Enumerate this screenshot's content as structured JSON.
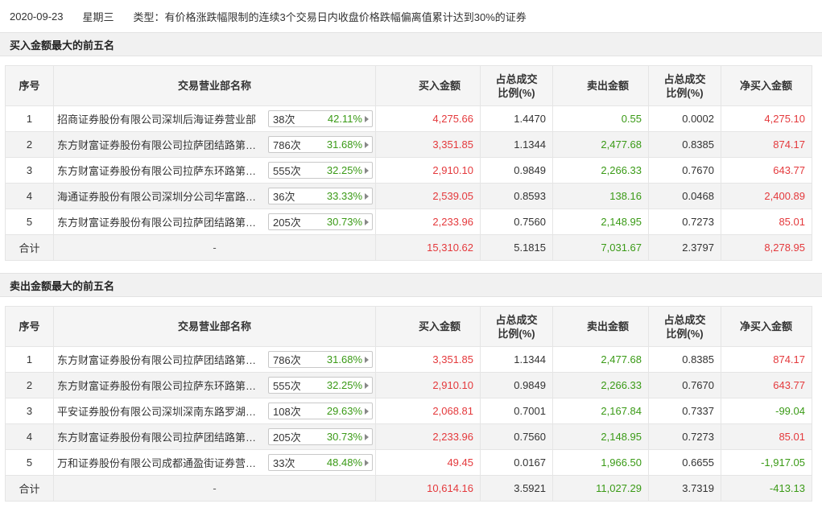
{
  "header": {
    "date": "2020-09-23",
    "weekday": "星期三",
    "type_text": "类型：有价格涨跌幅限制的连续3个交易日内收盘价格跌幅偏离值累计达到30%的证券"
  },
  "columns": {
    "seq": "序号",
    "dept": "交易营业部名称",
    "buy_amount": "买入金额",
    "buy_ratio_l1": "占总成交",
    "buy_ratio_l2": "比例(%)",
    "sell_amount": "卖出金额",
    "sell_ratio_l1": "占总成交",
    "sell_ratio_l2": "比例(%)",
    "net_buy": "净买入金额"
  },
  "colors": {
    "up": "#e4393c",
    "down": "#3a9a16"
  },
  "buy_top5": {
    "title": "买入金额最大的前五名",
    "rows": [
      {
        "seq": "1",
        "name": "招商证券股份有限公司深圳后海证券营业部",
        "times": "38次",
        "pct": "42.11%",
        "buy": "4,275.66",
        "buy_ratio": "1.4470",
        "sell": "0.55",
        "sell_ratio": "0.0002",
        "net": "4,275.10",
        "net_sign": "up"
      },
      {
        "seq": "2",
        "name": "东方财富证券股份有限公司拉萨团结路第二证券营业部",
        "times": "786次",
        "pct": "31.68%",
        "buy": "3,351.85",
        "buy_ratio": "1.1344",
        "sell": "2,477.68",
        "sell_ratio": "0.8385",
        "net": "874.17",
        "net_sign": "up"
      },
      {
        "seq": "3",
        "name": "东方财富证券股份有限公司拉萨东环路第二证券营业部",
        "times": "555次",
        "pct": "32.25%",
        "buy": "2,910.10",
        "buy_ratio": "0.9849",
        "sell": "2,266.33",
        "sell_ratio": "0.7670",
        "net": "643.77",
        "net_sign": "up"
      },
      {
        "seq": "4",
        "name": "海通证券股份有限公司深圳分公司华富路证券营业部",
        "times": "36次",
        "pct": "33.33%",
        "buy": "2,539.05",
        "buy_ratio": "0.8593",
        "sell": "138.16",
        "sell_ratio": "0.0468",
        "net": "2,400.89",
        "net_sign": "up"
      },
      {
        "seq": "5",
        "name": "东方财富证券股份有限公司拉萨团结路第一证券营业部",
        "times": "205次",
        "pct": "30.73%",
        "buy": "2,233.96",
        "buy_ratio": "0.7560",
        "sell": "2,148.95",
        "sell_ratio": "0.7273",
        "net": "85.01",
        "net_sign": "up"
      }
    ],
    "total": {
      "label": "合计",
      "name": "-",
      "buy": "15,310.62",
      "buy_ratio": "5.1815",
      "sell": "7,031.67",
      "sell_ratio": "2.3797",
      "net": "8,278.95",
      "net_sign": "up"
    }
  },
  "sell_top5": {
    "title": "卖出金额最大的前五名",
    "rows": [
      {
        "seq": "1",
        "name": "东方财富证券股份有限公司拉萨团结路第二证券营业部",
        "times": "786次",
        "pct": "31.68%",
        "buy": "3,351.85",
        "buy_ratio": "1.1344",
        "sell": "2,477.68",
        "sell_ratio": "0.8385",
        "net": "874.17",
        "net_sign": "up"
      },
      {
        "seq": "2",
        "name": "东方财富证券股份有限公司拉萨东环路第二证券营业部",
        "times": "555次",
        "pct": "32.25%",
        "buy": "2,910.10",
        "buy_ratio": "0.9849",
        "sell": "2,266.33",
        "sell_ratio": "0.7670",
        "net": "643.77",
        "net_sign": "up"
      },
      {
        "seq": "3",
        "name": "平安证券股份有限公司深圳深南东路罗湖商务中心证券营业部",
        "times": "108次",
        "pct": "29.63%",
        "buy": "2,068.81",
        "buy_ratio": "0.7001",
        "sell": "2,167.84",
        "sell_ratio": "0.7337",
        "net": "-99.04",
        "net_sign": "down"
      },
      {
        "seq": "4",
        "name": "东方财富证券股份有限公司拉萨团结路第一证券营业部",
        "times": "205次",
        "pct": "30.73%",
        "buy": "2,233.96",
        "buy_ratio": "0.7560",
        "sell": "2,148.95",
        "sell_ratio": "0.7273",
        "net": "85.01",
        "net_sign": "up"
      },
      {
        "seq": "5",
        "name": "万和证券股份有限公司成都通盈街证券营业部",
        "times": "33次",
        "pct": "48.48%",
        "buy": "49.45",
        "buy_ratio": "0.0167",
        "sell": "1,966.50",
        "sell_ratio": "0.6655",
        "net": "-1,917.05",
        "net_sign": "down"
      }
    ],
    "total": {
      "label": "合计",
      "name": "-",
      "buy": "10,614.16",
      "buy_ratio": "3.5921",
      "sell": "11,027.29",
      "sell_ratio": "3.7319",
      "net": "-413.13",
      "net_sign": "down"
    }
  }
}
